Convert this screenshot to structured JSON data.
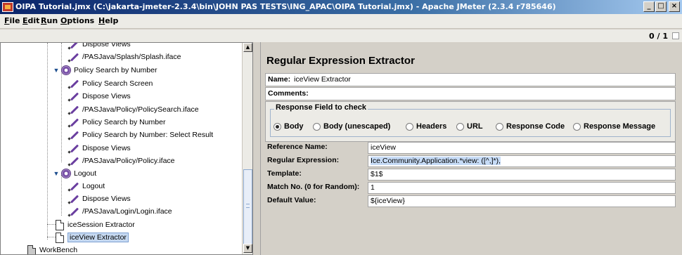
{
  "window": {
    "title": "OIPA Tutorial.jmx (C:\\jakarta-jmeter-2.3.4\\bin\\JOHN PAS TESTS\\ING_APAC\\OIPA Tutorial.jmx) - Apache JMeter (2.3.4 r785646)",
    "minimize": "_",
    "maximize": "□",
    "close": "×"
  },
  "menu": [
    "File",
    "Edit",
    "Run",
    "Options",
    "Help"
  ],
  "toolbar": {
    "counter": "0 / 1"
  },
  "tree": {
    "items": [
      {
        "label": "Dispose Views",
        "type": "sampler"
      },
      {
        "label": "/PASJava/Splash/Splash.iface",
        "type": "sampler"
      },
      {
        "label": "Policy Search by Number",
        "type": "controller"
      },
      {
        "label": "Policy Search Screen",
        "type": "sampler"
      },
      {
        "label": "Dispose Views",
        "type": "sampler"
      },
      {
        "label": "/PASJava/Policy/PolicySearch.iface",
        "type": "sampler"
      },
      {
        "label": "Policy Search by Number",
        "type": "sampler"
      },
      {
        "label": "Policy Search by Number: Select Result",
        "type": "sampler"
      },
      {
        "label": "Dispose Views",
        "type": "sampler"
      },
      {
        "label": "/PASJava/Policy/Policy.iface",
        "type": "sampler"
      },
      {
        "label": "Logout",
        "type": "controller"
      },
      {
        "label": "Logout",
        "type": "sampler"
      },
      {
        "label": "Dispose Views",
        "type": "sampler"
      },
      {
        "label": "/PASJava/Login/Login.iface",
        "type": "sampler"
      },
      {
        "label": "iceSession Extractor",
        "type": "extractor"
      },
      {
        "label": "iceView Extractor",
        "type": "extractor",
        "selected": true
      },
      {
        "label": "WorkBench",
        "type": "workbench"
      }
    ]
  },
  "editor": {
    "title": "Regular Expression Extractor",
    "name_label": "Name:",
    "name_value": "iceView Extractor",
    "comments_label": "Comments:",
    "comments_value": "",
    "response_legend": "Response Field to check",
    "radios": [
      {
        "label": "Body",
        "selected": true
      },
      {
        "label": "Body (unescaped)",
        "selected": false
      },
      {
        "label": "Headers",
        "selected": false
      },
      {
        "label": "URL",
        "selected": false
      },
      {
        "label": "Response Code",
        "selected": false
      },
      {
        "label": "Response Message",
        "selected": false
      }
    ],
    "reference_name_label": "Reference Name:",
    "reference_name_value": "iceView",
    "regex_label": "Regular Expression:",
    "regex_value": "Ice.Community.Application.*view: ([^,]*),",
    "template_label": "Template:",
    "template_value": "$1$",
    "match_label": "Match No. (0 for Random):",
    "match_value": "1",
    "default_label": "Default Value:",
    "default_value": "${iceView}"
  }
}
